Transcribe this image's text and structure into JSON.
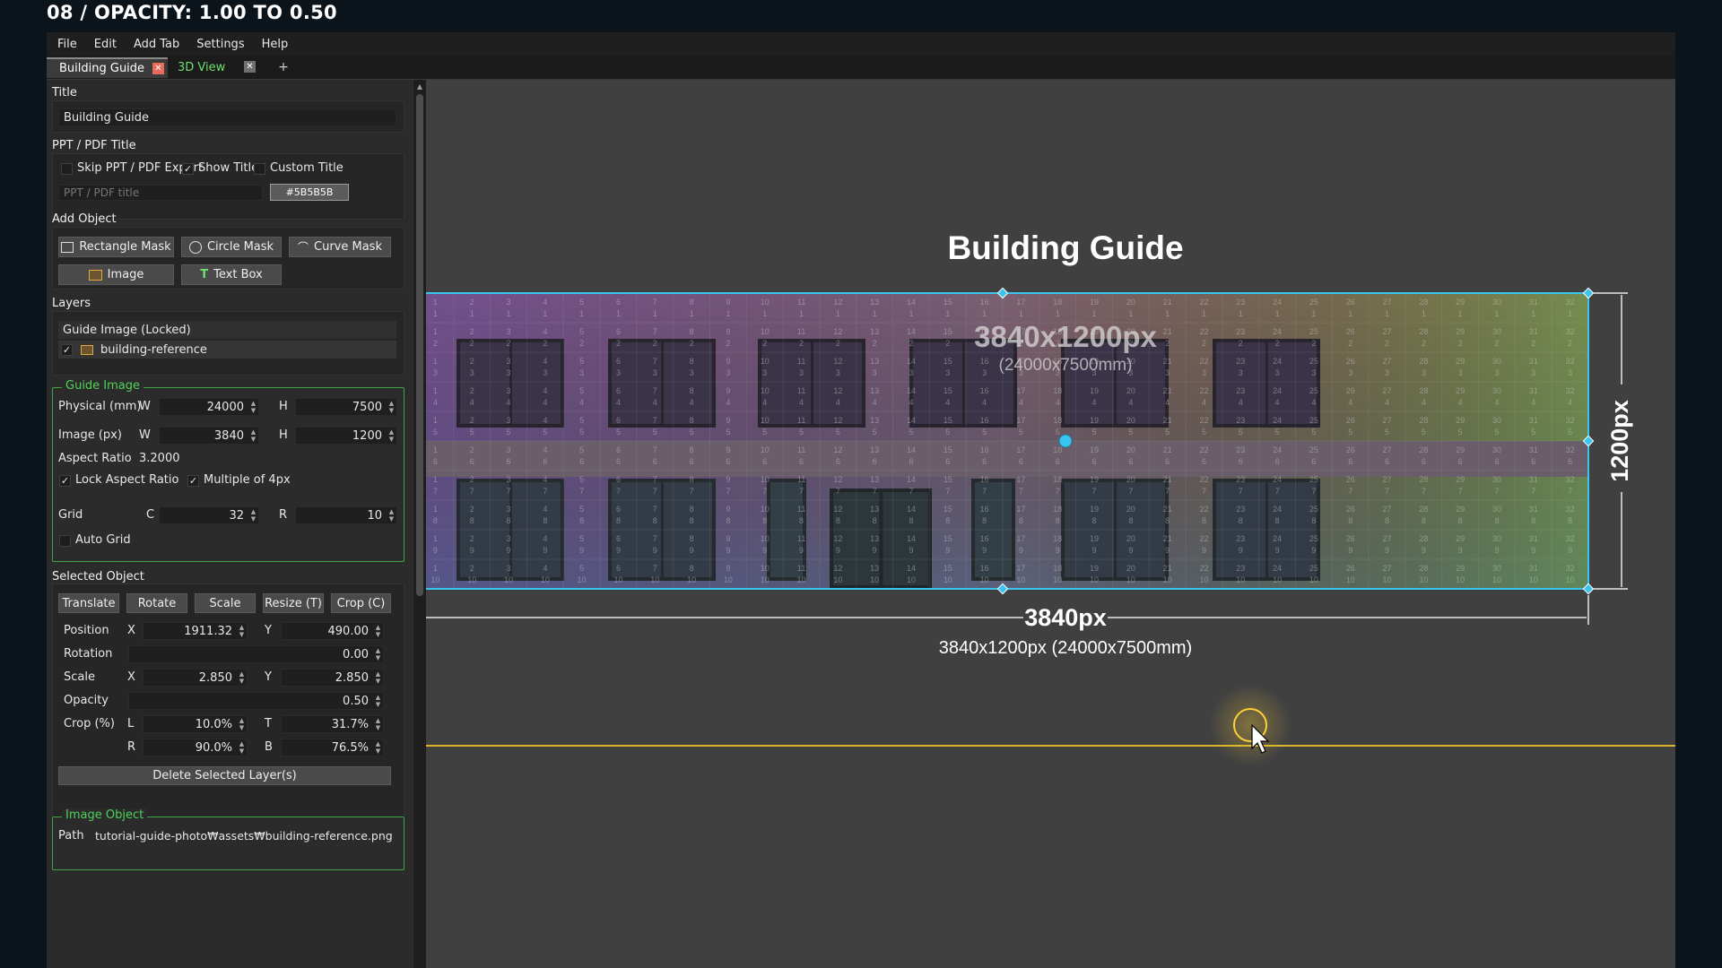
{
  "caption": "08 / OPACITY: 1.00 TO 0.50",
  "menu": [
    "File",
    "Edit",
    "Add Tab",
    "Settings",
    "Help"
  ],
  "tabs": {
    "active": "Building Guide",
    "inactive": "3D View",
    "add": "+"
  },
  "title_section": {
    "label": "Title",
    "value": "Building Guide"
  },
  "ppt": {
    "label": "PPT / PDF Title",
    "skip": "Skip PPT / PDF Export",
    "show_title": "Show Title",
    "custom_title": "Custom Title",
    "placeholder": "PPT / PDF title",
    "color": "#5B5B5B",
    "show_title_checked": true
  },
  "add_object": {
    "label": "Add Object",
    "rect": "Rectangle Mask",
    "circle": "Circle Mask",
    "curve": "Curve Mask",
    "image": "Image",
    "text": "Text Box"
  },
  "layers": {
    "label": "Layers",
    "group": "Guide Image (Locked)",
    "item": "building-reference"
  },
  "guide": {
    "label": "Guide Image",
    "physical_label": "Physical (mm)",
    "image_label": "Image (px)",
    "w": "W",
    "h": "H",
    "physical_w": "24000",
    "physical_h": "7500",
    "image_w": "3840",
    "image_h": "1200",
    "aspect_label": "Aspect Ratio",
    "aspect_value": "3.2000",
    "lock_aspect": "Lock Aspect Ratio",
    "multiple4": "Multiple of 4px",
    "grid_label": "Grid",
    "c": "C",
    "r": "R",
    "grid_c": "32",
    "grid_r": "10",
    "auto_grid": "Auto Grid"
  },
  "selected": {
    "label": "Selected Object",
    "translate": "Translate",
    "rotate": "Rotate",
    "scale": "Scale",
    "resize": "Resize (T)",
    "crop": "Crop (C)",
    "position_label": "Position",
    "x": "X",
    "y": "Y",
    "pos_x": "1911.32",
    "pos_y": "490.00",
    "rotation_label": "Rotation",
    "rotation": "0.00",
    "scale_label": "Scale",
    "scale_x": "2.850",
    "scale_y": "2.850",
    "opacity_label": "Opacity",
    "opacity": "0.50",
    "crop_label": "Crop (%)",
    "l": "L",
    "t": "T",
    "r": "R",
    "b": "B",
    "crop_l": "10.0%",
    "crop_t": "31.7%",
    "crop_r": "90.0%",
    "crop_b": "76.5%",
    "delete": "Delete Selected Layer(s)"
  },
  "image_object": {
    "label": "Image Object",
    "path_label": "Path",
    "path": "tutorial-guide-photo₩assets₩building-reference.png"
  },
  "canvas": {
    "title": "Building Guide",
    "overlay_size": "3840x1200px",
    "overlay_mm": "(24000x7500mm)",
    "width_label": "3840px",
    "height_label": "1200px",
    "dims": "3840x1200px (24000x7500mm)",
    "grid_cols": 32,
    "grid_rows": 10,
    "accent": "#39c5ee",
    "guide_line": "#d8b52a"
  }
}
